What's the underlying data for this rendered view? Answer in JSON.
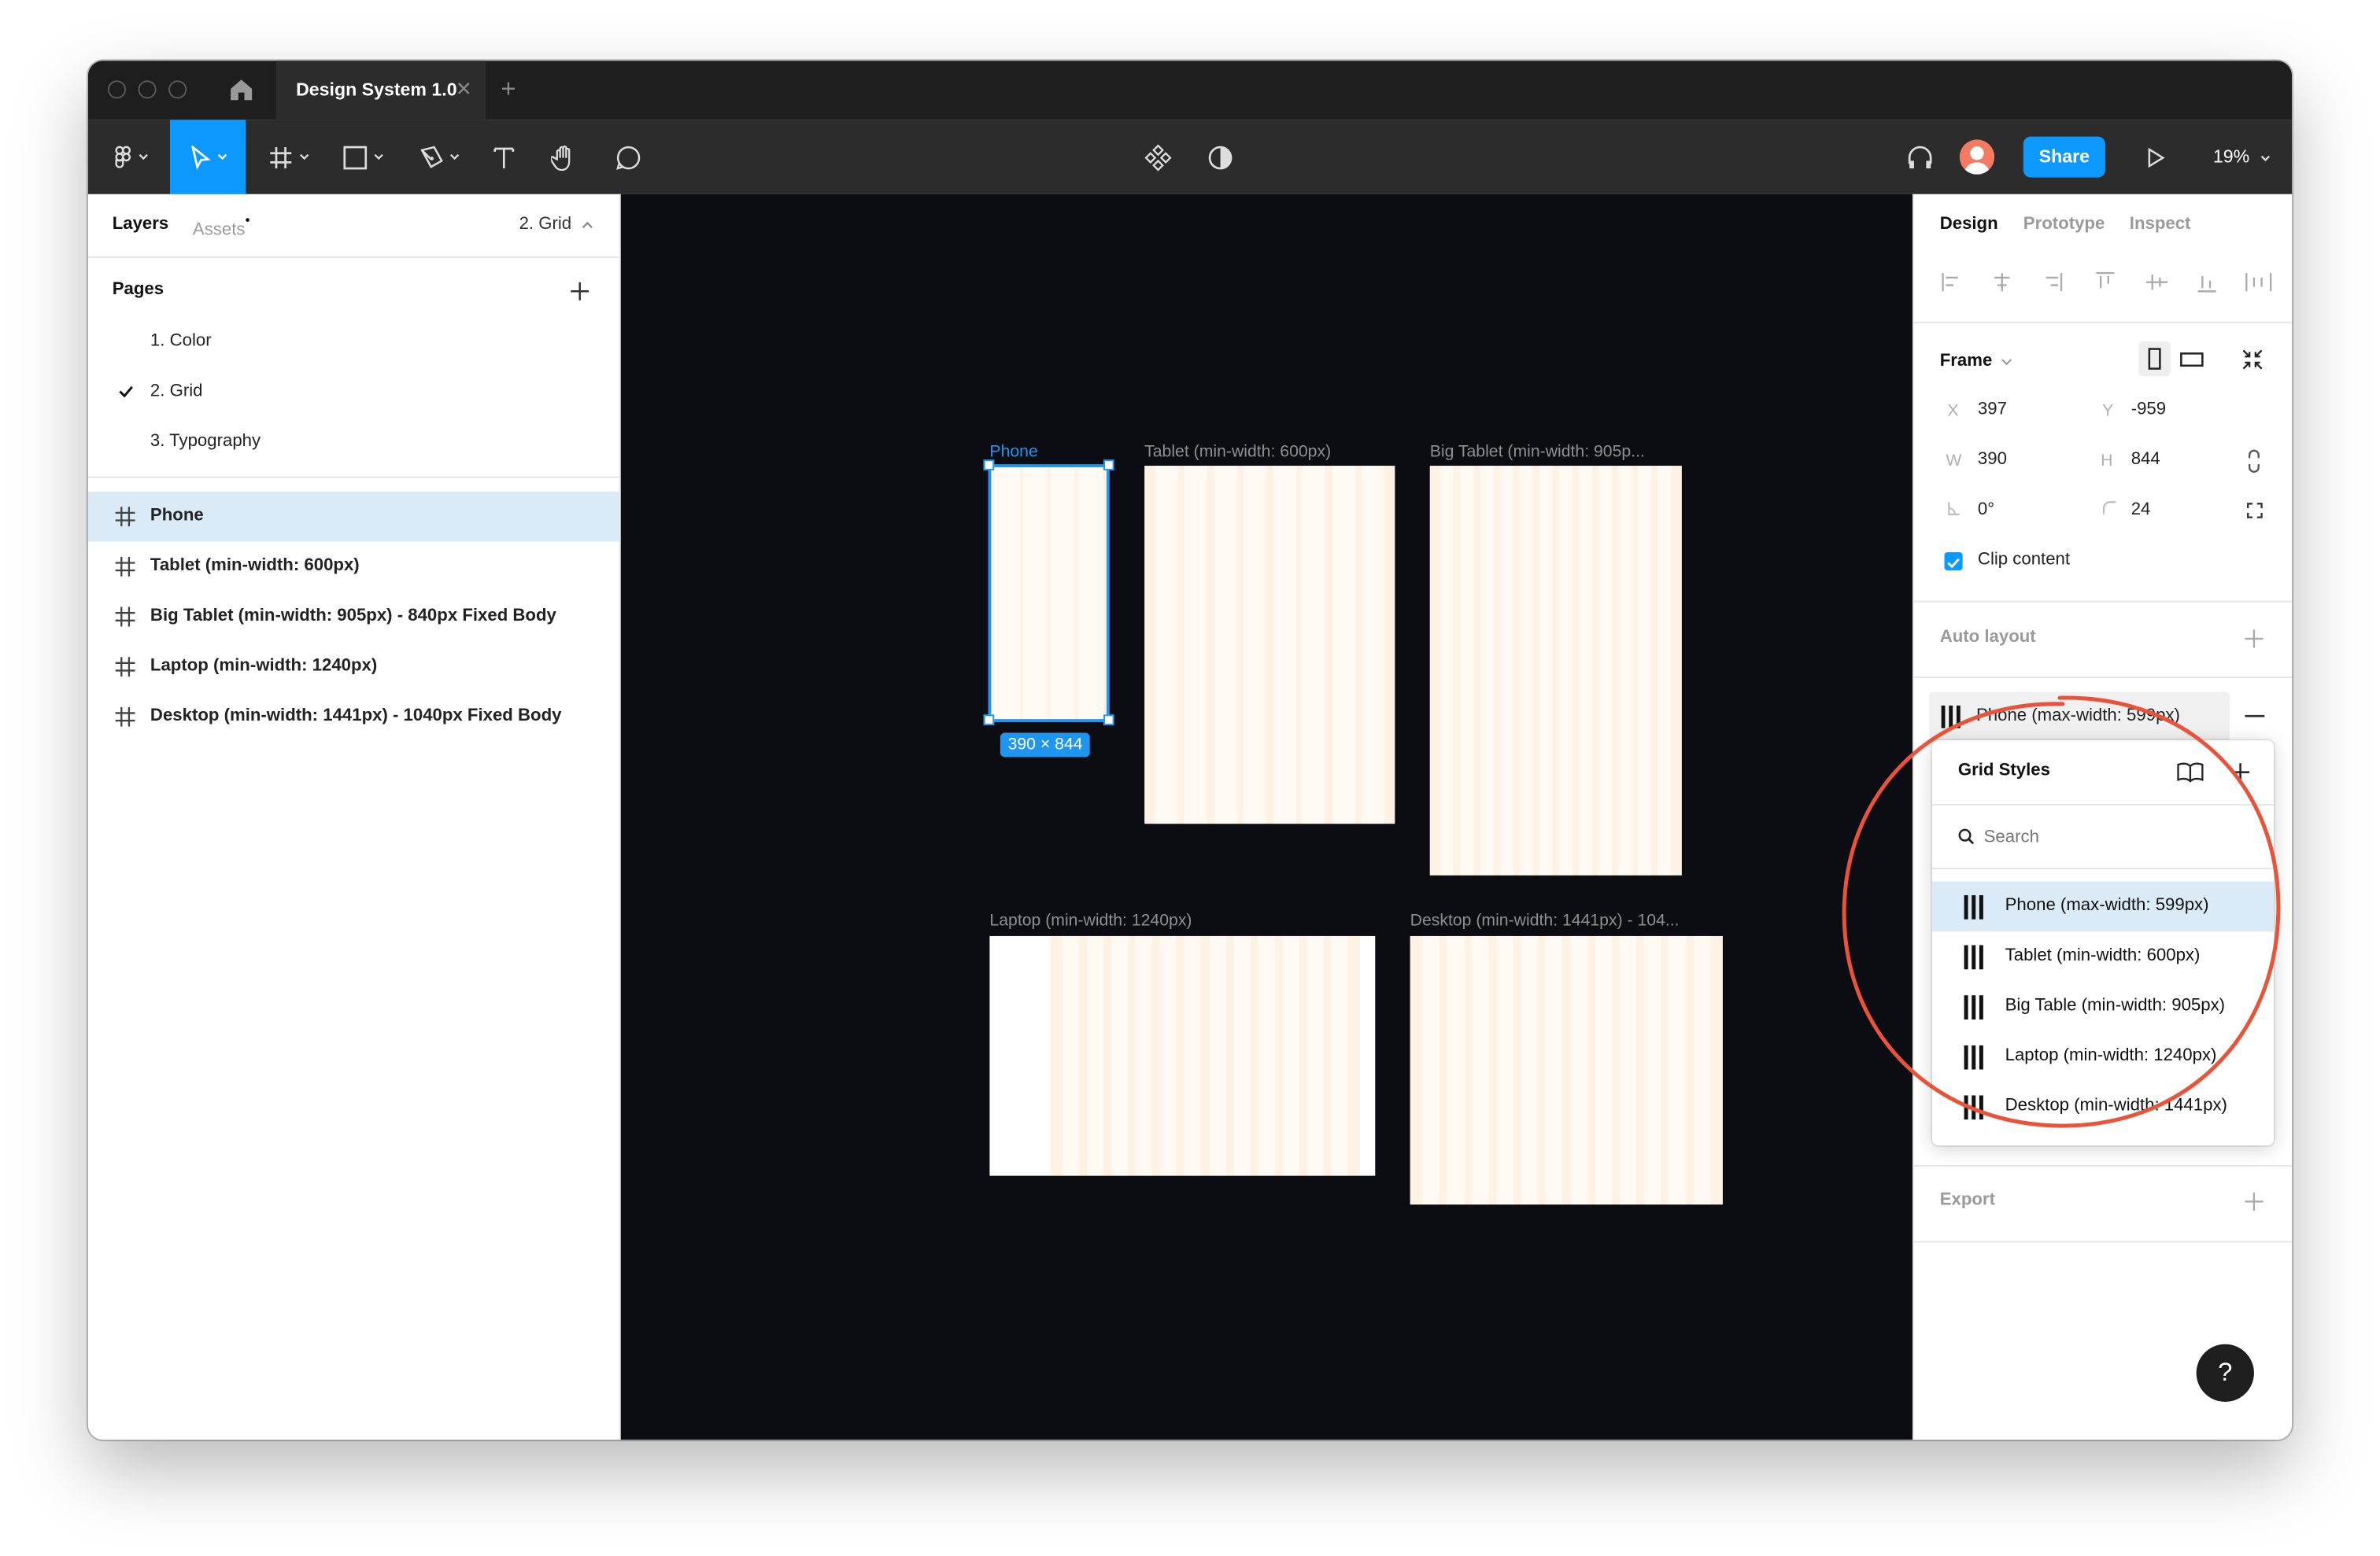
{
  "app": {
    "tab_title": "Design System 1.0",
    "tab_close": "✕",
    "new_tab": "+",
    "zoom": "19%",
    "share_label": "Share",
    "colors": {
      "accent": "#0d99ff",
      "canvas": "#0c0d12",
      "grid_fill": "#fef2e4",
      "annotation": "#e8533a"
    }
  },
  "left_panel": {
    "tabs": {
      "layers": "Layers",
      "assets": "Assets",
      "current_page": "2. Grid"
    },
    "pages_title": "Pages",
    "pages": [
      {
        "label": "1. Color",
        "selected": false
      },
      {
        "label": "2. Grid",
        "selected": true
      },
      {
        "label": "3. Typography",
        "selected": false
      }
    ],
    "layers": [
      {
        "label": "Phone",
        "selected": true
      },
      {
        "label": "Tablet (min-width: 600px)",
        "selected": false
      },
      {
        "label": "Big Tablet (min-width: 905px) - 840px Fixed Body",
        "selected": false
      },
      {
        "label": "Laptop (min-width: 1240px)",
        "selected": false
      },
      {
        "label": "Desktop (min-width: 1441px) - 1040px Fixed Body",
        "selected": false
      }
    ]
  },
  "canvas": {
    "frames": [
      {
        "label": "Phone",
        "selected": true
      },
      {
        "label": "Tablet (min-width: 600px)"
      },
      {
        "label": "Big Tablet (min-width: 905p..."
      },
      {
        "label": "Laptop (min-width: 1240px)"
      },
      {
        "label": "Desktop (min-width: 1441px) - 104..."
      }
    ],
    "selection_size": "390 × 844"
  },
  "right_panel": {
    "tabs": {
      "design": "Design",
      "prototype": "Prototype",
      "inspect": "Inspect"
    },
    "frame_title": "Frame",
    "props": {
      "x_label": "X",
      "x": "397",
      "y_label": "Y",
      "y": "-959",
      "w_label": "W",
      "w": "390",
      "h_label": "H",
      "h": "844",
      "rotation": "0°",
      "radius": "24"
    },
    "clip_content": "Clip content",
    "auto_layout": "Auto layout",
    "layout_grid_value": "Phone (max-width: 599px)",
    "export": "Export"
  },
  "grid_styles": {
    "title": "Grid Styles",
    "search_placeholder": "Search",
    "items": [
      {
        "label": "Phone (max-width: 599px)",
        "selected": true
      },
      {
        "label": "Tablet (min-width: 600px)",
        "selected": false
      },
      {
        "label": "Big Table (min-width: 905px)",
        "selected": false
      },
      {
        "label": "Laptop (min-width: 1240px)",
        "selected": false
      },
      {
        "label": "Desktop (min-width: 1441px)",
        "selected": false
      }
    ]
  },
  "help_label": "?"
}
